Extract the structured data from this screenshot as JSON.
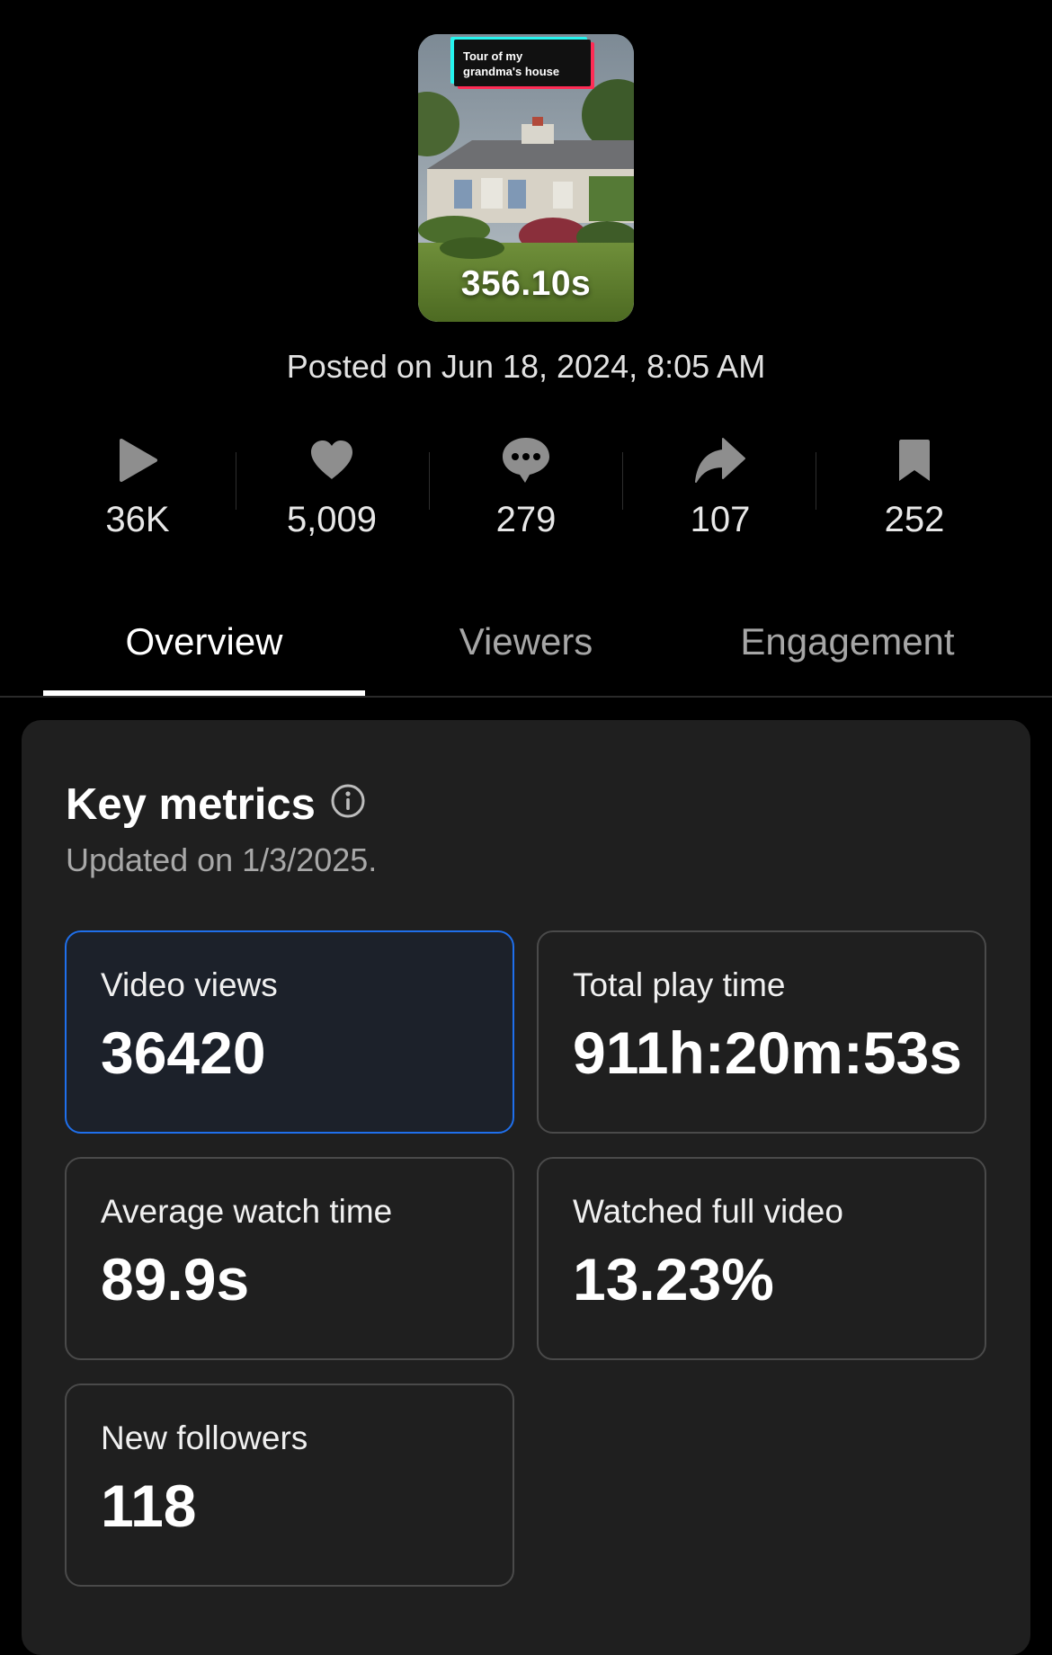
{
  "video": {
    "caption_line1": "Tour of my",
    "caption_line2": "grandma's house",
    "duration": "356.10s"
  },
  "posted": "Posted on Jun 18, 2024, 8:05 AM",
  "stats": [
    {
      "icon": "play-icon",
      "value": "36K"
    },
    {
      "icon": "heart-icon",
      "value": "5,009"
    },
    {
      "icon": "comment-icon",
      "value": "279"
    },
    {
      "icon": "share-icon",
      "value": "107"
    },
    {
      "icon": "bookmark-icon",
      "value": "252"
    }
  ],
  "tabs": {
    "overview": "Overview",
    "viewers": "Viewers",
    "engagement": "Engagement",
    "active": "overview"
  },
  "key_metrics": {
    "title": "Key metrics",
    "updated": "Updated on 1/3/2025.",
    "cards": [
      {
        "label": "Video views",
        "value": "36420",
        "selected": true
      },
      {
        "label": "Total play time",
        "value": "911h:20m:53s",
        "selected": false
      },
      {
        "label": "Average watch time",
        "value": "89.9s",
        "selected": false
      },
      {
        "label": "Watched full video",
        "value": "13.23%",
        "selected": false
      },
      {
        "label": "New followers",
        "value": "118",
        "selected": false
      }
    ]
  },
  "colors": {
    "background": "#000000",
    "panel": "#1f1f1f",
    "selected_border": "#1f6feb",
    "muted_text": "#a6a6a6"
  }
}
